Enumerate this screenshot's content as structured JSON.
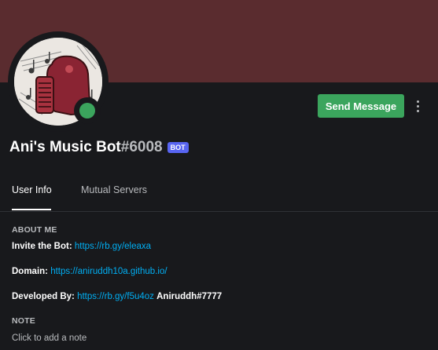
{
  "profile": {
    "username": "Ani's Music Bot",
    "discriminator": "#6008",
    "bot_badge": "BOT",
    "status": "online",
    "avatar_icon": "music-bot-avatar-icon"
  },
  "colors": {
    "banner": "#5a2c2f",
    "accent_green": "#3ba55d",
    "bot_badge": "#5865f2",
    "link": "#00aff4"
  },
  "actions": {
    "send_message": "Send Message",
    "more_icon": "more-vertical-icon"
  },
  "tabs": [
    {
      "label": "User Info",
      "active": true
    },
    {
      "label": "Mutual Servers",
      "active": false
    }
  ],
  "about_me": {
    "heading": "ABOUT ME",
    "invite_label": "Invite the Bot:",
    "invite_link": "https://rb.gy/eleaxa",
    "domain_label": "Domain:",
    "domain_link": "https://aniruddh10a.github.io/",
    "dev_label": "Developed By:",
    "dev_link": "https://rb.gy/f5u4oz",
    "dev_name": "Aniruddh#7777"
  },
  "note": {
    "heading": "NOTE",
    "placeholder": "Click to add a note"
  }
}
